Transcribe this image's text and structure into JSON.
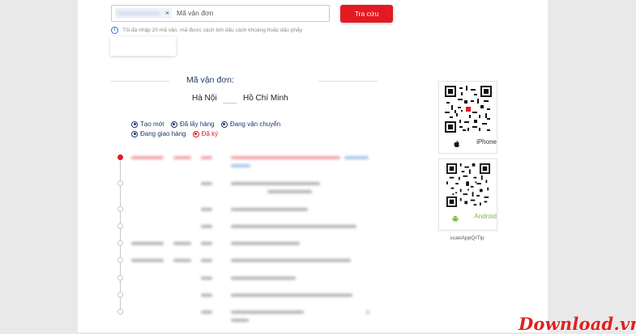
{
  "search": {
    "placeholder": "Mã vận đơn",
    "chip_close": "×",
    "button": "Tra cứu",
    "hint": "Tối đa nhập 20 mã vận, mã được cách bởi dấu cách khoảng hoặc dấu phẩy",
    "info_glyph": "i"
  },
  "result": {
    "title": "Mã vận đơn:",
    "from": "Hà Nội",
    "to": "Hồ Chí Minh"
  },
  "filters": [
    {
      "label": "Tạo mới",
      "active": false
    },
    {
      "label": "Đã lấy hàng",
      "active": false
    },
    {
      "label": "Đang vận chuyển",
      "active": false
    },
    {
      "label": "Đang giao hàng",
      "active": false
    },
    {
      "label": "Đã ký",
      "active": true
    }
  ],
  "qr": {
    "iphone": "iPhone",
    "android": "Android",
    "scan_tip": "scanAppQrTip"
  },
  "watermark": "Download.vn",
  "colors": {
    "accent_red": "#e31a22",
    "title_navy": "#1e3a6b",
    "android_green": "#78b948"
  }
}
